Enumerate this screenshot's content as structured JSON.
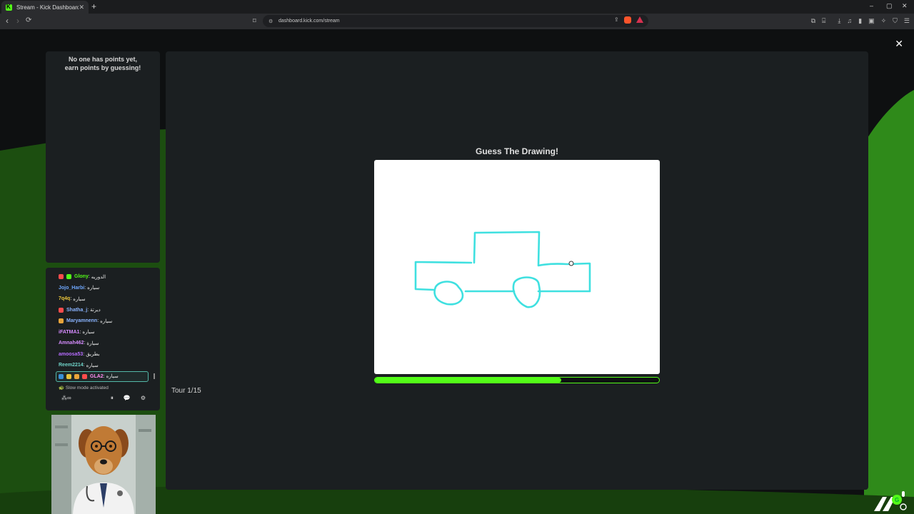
{
  "browser": {
    "tab_title": "Stream - Kick Dashboard",
    "new_tab": "+",
    "tab_close": "✕",
    "url": "dashboard.kick.com/stream",
    "window_controls": {
      "minimize": "–",
      "maximize": "▢",
      "close": "✕"
    }
  },
  "page": {
    "close_symbol": "✕",
    "leaderboard_message": [
      "No one has points yet,",
      "earn points by guessing!"
    ],
    "game": {
      "title": "Guess The Drawing!",
      "round_label": "Tour 1/15",
      "timer_progress": 0.655
    },
    "chat": {
      "messages": [
        {
          "user": "Glony",
          "text": "الدوريه",
          "color": "#53fc18",
          "badges": [
            "#fc4c4c",
            "#53fc18"
          ]
        },
        {
          "user": "Jojo_Harbi",
          "text": "سياره",
          "color": "#6fa8ff",
          "badges": []
        },
        {
          "user": "7q4q",
          "text": "سياره",
          "color": "#e8c33a",
          "badges": []
        },
        {
          "user": "Shatha_j",
          "text": "ديرتة",
          "color": "#8ab4ff",
          "badges": [
            "#fc4c4c"
          ]
        },
        {
          "user": "Maryamnenn",
          "text": "سياره",
          "color": "#8ab4ff",
          "badges": [
            "#e8a43a"
          ]
        },
        {
          "user": "iFATMA1",
          "text": "سياره",
          "color": "#d68cff",
          "badges": []
        },
        {
          "user": "Amnah462",
          "text": "سيارة",
          "color": "#d68cff",
          "badges": []
        },
        {
          "user": "amoosa53",
          "text": "بطريق",
          "color": "#b76cff",
          "badges": []
        },
        {
          "user": "Reem2214",
          "text": "سياره",
          "color": "#6fd3c8",
          "badges": []
        },
        {
          "user": "GLA2",
          "text": "سياره",
          "color": "#ff8cf0",
          "badges": [
            "#3a8fd6",
            "#e8c33a",
            "#e8a43a",
            "#fc4c4c"
          ],
          "highlight": true
        }
      ],
      "slow_mode": "Slow mode activated"
    }
  }
}
